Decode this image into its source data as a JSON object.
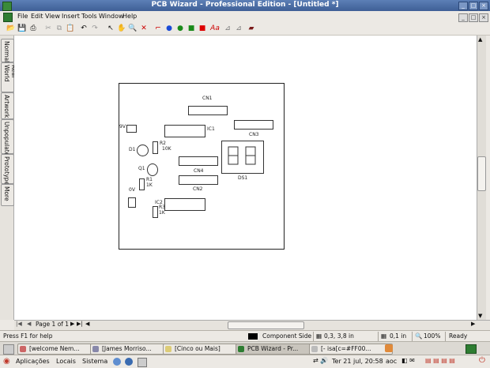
{
  "window": {
    "title": "PCB Wizard - Professional Edition - [Untitled *]"
  },
  "menu": [
    "File",
    "Edit",
    "View",
    "Insert",
    "Tools",
    "Window",
    "Help"
  ],
  "sidebar_tabs": [
    "Normal",
    "Real World",
    "Artwork",
    "Unpopulated",
    "Prototype",
    "More"
  ],
  "board": {
    "labels": {
      "cn1": "CN1",
      "cn2": "CN2",
      "cn3": "CN3",
      "cn4": "CN4",
      "ic1": "IC1",
      "ic2": "IC2",
      "ds1": "DS1",
      "d1": "D1",
      "q1": "Q1",
      "r1": "R1",
      "r1v": "1K",
      "r2": "R2",
      "r2v": "10K",
      "r3": "R3",
      "r3v": "1K",
      "v9": "9V",
      "v0": "0V"
    }
  },
  "page_nav": {
    "label": "Page 1 of 1"
  },
  "status": {
    "help": "Press F1 for help",
    "layer": "Component Side",
    "coords": "0,3, 3,8 in",
    "grid": "0,1 in",
    "zoom": "100%",
    "state": "Ready"
  },
  "taskbar": [
    "[welcome Nem...",
    "[James Morriso...",
    "[Cinco ou Mais]",
    "PCB Wizard - Pr...",
    "[- isa[c=#FF00..."
  ],
  "panel": {
    "apps": "Aplicações",
    "places": "Locais",
    "system": "Sistema",
    "clock": "Ter 21 jul, 20:58",
    "user": "aoc"
  },
  "colors": {
    "titlebar": "#4a6ba6",
    "canvas": "#ffffff",
    "accent_green": "#2e7d32"
  }
}
